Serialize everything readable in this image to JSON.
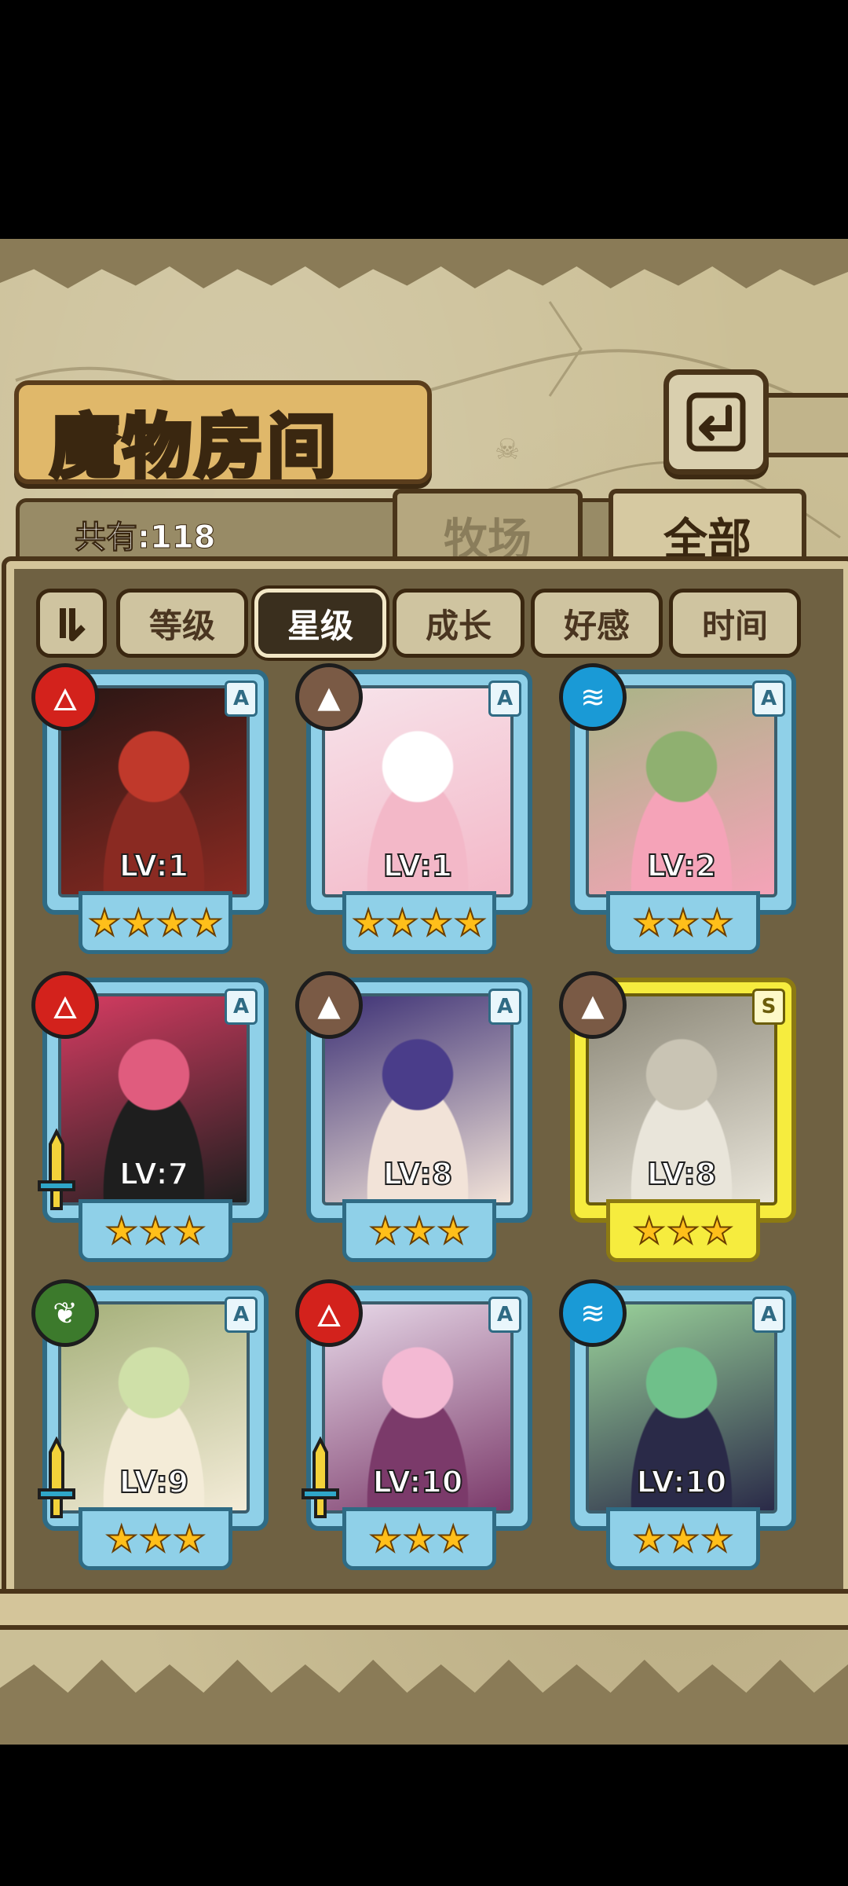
{
  "title": "魔物房间",
  "count_label": "共有:118",
  "tabs": [
    {
      "label": "牧场",
      "active": false
    },
    {
      "label": "全部",
      "active": true
    }
  ],
  "sort_buttons": [
    {
      "label": "等级",
      "active": false
    },
    {
      "label": "星级",
      "active": true
    },
    {
      "label": "成长",
      "active": false
    },
    {
      "label": "好感",
      "active": false
    },
    {
      "label": "时间",
      "active": false
    }
  ],
  "monsters": [
    {
      "level": "LV:1",
      "rank": "A",
      "element": "fire",
      "stars": 4,
      "frame": "blue",
      "weapon": false,
      "art": [
        "#2a1614",
        "#8a2a22",
        "#c0392b"
      ]
    },
    {
      "level": "LV:1",
      "rank": "A",
      "element": "earth",
      "stars": 4,
      "frame": "blue",
      "weapon": false,
      "art": [
        "#f7e3ea",
        "#f3b8c8",
        "#ffffff"
      ]
    },
    {
      "level": "LV:2",
      "rank": "A",
      "element": "water",
      "stars": 3,
      "frame": "blue",
      "weapon": false,
      "art": [
        "#aab487",
        "#f5a3b8",
        "#8fb070"
      ]
    },
    {
      "level": "LV:7",
      "rank": "A",
      "element": "fire",
      "stars": 3,
      "frame": "blue",
      "weapon": true,
      "art": [
        "#d63c62",
        "#1e1e1e",
        "#e05c7e"
      ]
    },
    {
      "level": "LV:8",
      "rank": "A",
      "element": "earth",
      "stars": 3,
      "frame": "blue",
      "weapon": false,
      "art": [
        "#3e3276",
        "#f2e3d8",
        "#4a3d8a"
      ]
    },
    {
      "level": "LV:8",
      "rank": "S",
      "element": "earth",
      "stars": 3,
      "frame": "gold",
      "weapon": false,
      "art": [
        "#8a8676",
        "#e9e5da",
        "#c9c4b4"
      ]
    },
    {
      "level": "LV:9",
      "rank": "A",
      "element": "wood",
      "stars": 3,
      "frame": "blue",
      "weapon": true,
      "art": [
        "#a5b07a",
        "#f4ecd8",
        "#cfe0a8"
      ]
    },
    {
      "level": "LV:10",
      "rank": "A",
      "element": "fire",
      "stars": 3,
      "frame": "blue",
      "weapon": true,
      "art": [
        "#e7d8e8",
        "#7b3a6a",
        "#f3b9d3"
      ]
    },
    {
      "level": "LV:10",
      "rank": "A",
      "element": "water",
      "stars": 3,
      "frame": "blue",
      "weapon": false,
      "art": [
        "#9ad29a",
        "#2a2a48",
        "#6fc08a"
      ]
    }
  ],
  "colors": {
    "frame_blue": "#8fd0e8",
    "frame_gold": "#f6ec3e",
    "fire": "#d3221c",
    "earth": "#7a5a45",
    "water": "#1a9ad6",
    "wood": "#3c7a2c",
    "star": "#ffbf1a"
  }
}
